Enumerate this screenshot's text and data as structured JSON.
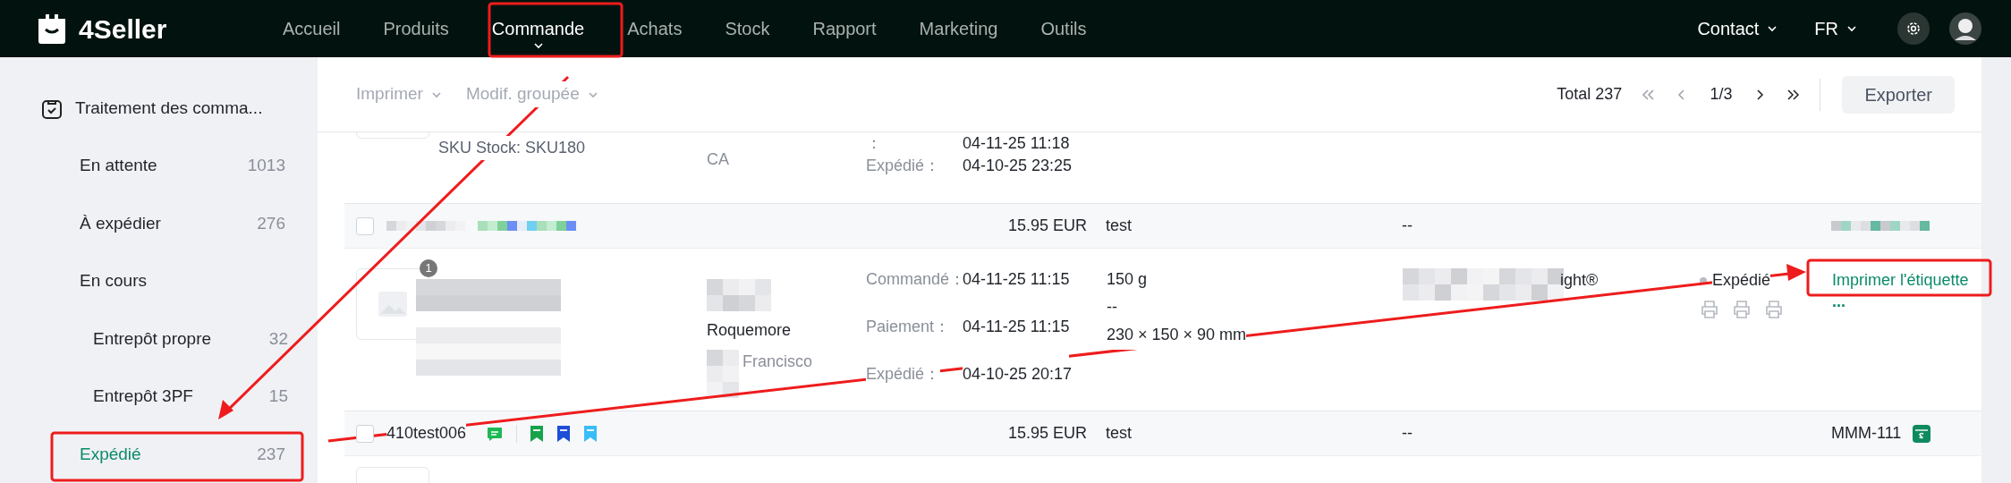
{
  "header": {
    "logo": "4Seller",
    "nav": [
      {
        "label": "Accueil",
        "selected": false
      },
      {
        "label": "Produits",
        "selected": false
      },
      {
        "label": "Commande",
        "selected": true
      },
      {
        "label": "Achats",
        "selected": false
      },
      {
        "label": "Stock",
        "selected": false
      },
      {
        "label": "Rapport",
        "selected": false
      },
      {
        "label": "Marketing",
        "selected": false
      },
      {
        "label": "Outils",
        "selected": false
      }
    ],
    "contact": "Contact",
    "language": "FR"
  },
  "sidebar": {
    "section": "Traitement des comma...",
    "items": [
      {
        "label": "En attente",
        "count": "1013",
        "selected": false
      },
      {
        "label": "À expédier",
        "count": "276",
        "selected": false
      },
      {
        "label": "En cours",
        "selected": false,
        "children": [
          {
            "label": "Entrepôt propre",
            "count": "32",
            "selected": false
          },
          {
            "label": "Entrepôt 3PF",
            "count": "15",
            "selected": false
          }
        ]
      },
      {
        "label": "Expédié",
        "count": "237",
        "selected": true
      }
    ]
  },
  "toolbar": {
    "menus": [
      "Imprimer",
      "Modif. groupée"
    ],
    "total": "Total 237",
    "page": "1/3",
    "export": "Exporter"
  },
  "partial_row": {
    "sku": "SKU Stock: SKU180",
    "region": "CA",
    "dates": [
      {
        "label": "：",
        "value": "04-11-25 11:18"
      },
      {
        "label": "Expédié：",
        "value": "04-10-25 23:25"
      }
    ]
  },
  "orders": [
    {
      "checked": false,
      "price": "15.95 EUR",
      "note": "test",
      "tracking": "--",
      "detail": {
        "badge": "1",
        "customer": "Roquemore",
        "city": "Francisco",
        "dates": [
          {
            "label": "Commandé：",
            "value": "04-11-25 11:15"
          },
          {
            "label": "Paiement：",
            "value": "04-11-25 11:15"
          },
          {
            "label": "Expédié：",
            "value": "04-10-25 20:17"
          }
        ],
        "weight": "150 g",
        "volume_weight": "--",
        "dimensions": "230 × 150 × 90 mm",
        "carrier": "ight®",
        "status": "Expédié",
        "action": "Imprimer l'étiquette",
        "more": "..."
      }
    },
    {
      "checked": false,
      "order_id": "410test006",
      "flags": [
        {
          "kind": "message",
          "color": "#1db954"
        },
        {
          "kind": "bookmark",
          "color": "#16a34a"
        },
        {
          "kind": "bookmark",
          "color": "#1d4ed8"
        },
        {
          "kind": "bookmark",
          "color": "#38bdf8"
        }
      ],
      "price": "15.95 EUR",
      "note": "test",
      "tracking": "--",
      "store": "MMM-111"
    }
  ]
}
